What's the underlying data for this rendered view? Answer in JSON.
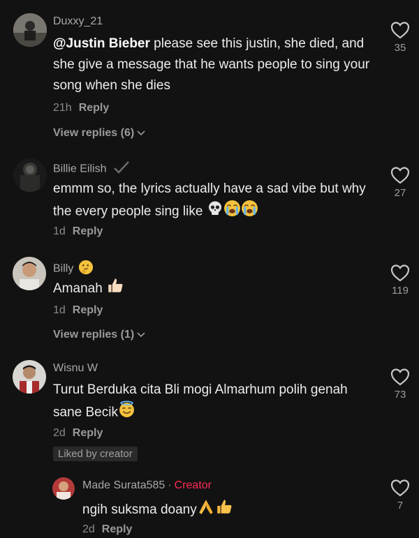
{
  "colors": {
    "background": "#121212",
    "creator": "#fe2c55",
    "text": "#ececec",
    "muted": "#8a8a8a"
  },
  "comments": [
    {
      "username": "Duxxy_21",
      "mention": "@Justin Bieber",
      "text_after_mention": " please see this justin, she died, and she give a message that he wants people to sing your song when she dies",
      "time": "21h",
      "reply_label": "Reply",
      "view_replies": "View replies (6)",
      "likes": "35"
    },
    {
      "username": "Billie Eilish",
      "verified_icon": "checkmark-icon",
      "text": "emmm so, the lyrics actually have a sad vibe but why the every people sing like",
      "trailing_emoji": [
        "skull-emoji",
        "crying-emoji",
        "crying-emoji"
      ],
      "time": "1d",
      "reply_label": "Reply",
      "likes": "27"
    },
    {
      "username": "Billy",
      "name_emoji": "thinking-emoji",
      "text": "Amanah",
      "trailing_emoji": [
        "thumbs-up-emoji"
      ],
      "time": "1d",
      "reply_label": "Reply",
      "view_replies": "View replies (1)",
      "likes": "119"
    },
    {
      "username": "Wisnu W",
      "text": "Turut Berduka cita Bli mogi Almarhum polih genah sane Becik",
      "trailing_emoji": [
        "halo-smile-emoji"
      ],
      "time": "2d",
      "reply_label": "Reply",
      "liked_by_creator": "Liked by creator",
      "likes": "73"
    },
    {
      "username": "Made Surata585",
      "creator_label": "Creator",
      "separator": "·",
      "text": "ngih suksma doany",
      "trailing_emoji": [
        "folded-hands-emoji",
        "thumbs-up-emoji"
      ],
      "time": "2d",
      "reply_label": "Reply",
      "likes": "7"
    }
  ]
}
